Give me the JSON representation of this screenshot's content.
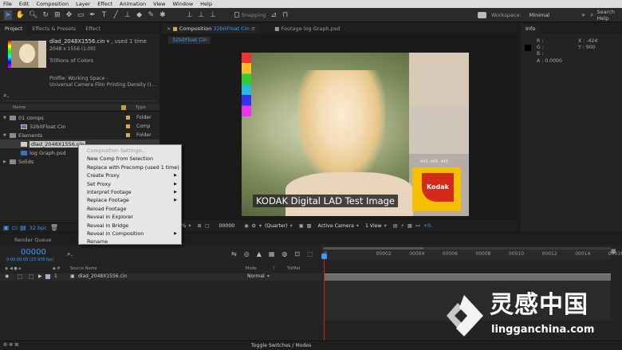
{
  "menubar": [
    "File",
    "Edit",
    "Composition",
    "Layer",
    "Effect",
    "Animation",
    "View",
    "Window",
    "Help"
  ],
  "toolbar": {
    "snapping_label": "Snapping",
    "workspace_label": "Workspace:",
    "workspace_value": "Minimal",
    "search_placeholder": "Search Help"
  },
  "project": {
    "tabs": [
      "Project",
      "Effects & Presets",
      "Effect"
    ],
    "file_name": "dlad_2048X1556.cin",
    "used_text": ", used 1 time",
    "dims": "2048 x 1556 (1.00)",
    "colors": "Trillions of Colors",
    "profile_line1": "Profile: Working Space -",
    "profile_line2": "Universal Camera Film Printing Density (I...",
    "search_icon": "search-icon",
    "col_name": "Name",
    "col_type": "Type",
    "items": [
      {
        "name": "01 comps",
        "type": "Folder",
        "indent": 0,
        "kind": "folder",
        "expanded": true
      },
      {
        "name": "32bitFloat Cin",
        "type": "Comp",
        "indent": 1,
        "kind": "comp"
      },
      {
        "name": "Elements",
        "type": "Folder",
        "indent": 0,
        "kind": "folder",
        "expanded": true
      },
      {
        "name": "dlad_2048X1556.cin",
        "type": "",
        "indent": 1,
        "kind": "footage",
        "selected": true
      },
      {
        "name": "log Graph.psd",
        "type": "",
        "indent": 1,
        "kind": "psd"
      },
      {
        "name": "Solids",
        "type": "",
        "indent": 0,
        "kind": "folder",
        "expanded": false
      }
    ],
    "bpc": "32 bpc"
  },
  "context_menu": [
    {
      "label": "Composition Settings...",
      "disabled": true,
      "submenu": false
    },
    {
      "label": "New Comp from Selection",
      "disabled": false,
      "submenu": false
    },
    {
      "label": "Replace with Precomp (used 1 time)",
      "disabled": false,
      "submenu": false
    },
    {
      "label": "Create Proxy",
      "disabled": false,
      "submenu": true
    },
    {
      "label": "Set Proxy",
      "disabled": false,
      "submenu": true
    },
    {
      "label": "Interpret Footage",
      "disabled": false,
      "submenu": true
    },
    {
      "label": "Replace Footage",
      "disabled": false,
      "submenu": true
    },
    {
      "label": "Reload Footage",
      "disabled": false,
      "submenu": false
    },
    {
      "label": "Reveal in Explorer",
      "disabled": false,
      "submenu": false
    },
    {
      "label": "Reveal in Bridge",
      "disabled": false,
      "submenu": false
    },
    {
      "label": "Reveal in Composition",
      "disabled": false,
      "submenu": true
    },
    {
      "label": "Rename",
      "disabled": false,
      "submenu": false
    }
  ],
  "composition": {
    "tab_title": "Composition",
    "comp_name": "32bitFloat Cin",
    "footage_tab": "Footage log Graph.psd",
    "subtab": "32bitFloat Cin",
    "image_caption": "KODAK Digital LAD Test Image",
    "patch_label": "445, 445, 445",
    "kodak_logo": "Kodak",
    "zoom": "25%",
    "timecode": "00000",
    "resolution": "(Quarter)",
    "camera": "Active Camera",
    "views": "1 View",
    "offset": "+0."
  },
  "info": {
    "title": "Info",
    "r": "R :",
    "g": "G :",
    "b": "B :",
    "a": "A : 0.0000",
    "x": "X : -424",
    "y": "Y : 900"
  },
  "timeline": {
    "render_queue_tab": "Render Queue",
    "comp_tab": "32bitFloat Cin",
    "timecode": "00000",
    "fps": "0:00:00:00 (23.976 fps)",
    "col_source": "Source Name",
    "col_mode": "Mode",
    "col_trkmat": "TrkMat",
    "layer_index": "1",
    "layer_name": "dlad_2048X1556.cin",
    "layer_mode": "Normal",
    "ticks": [
      "0",
      "00002",
      "00004",
      "00006",
      "00008",
      "00010",
      "00012",
      "00014",
      "00016"
    ],
    "toggle_label": "Toggle Switches / Modes"
  },
  "watermark": {
    "brand": "灵感中国",
    "url": "lingganchina.com"
  },
  "colors": {
    "accent_blue": "#3b9bff",
    "playhead_red": "#d02020",
    "layer_bar": "#6e6e6e",
    "kodak_yellow": "#f5c000",
    "kodak_red": "#d42a1a"
  }
}
